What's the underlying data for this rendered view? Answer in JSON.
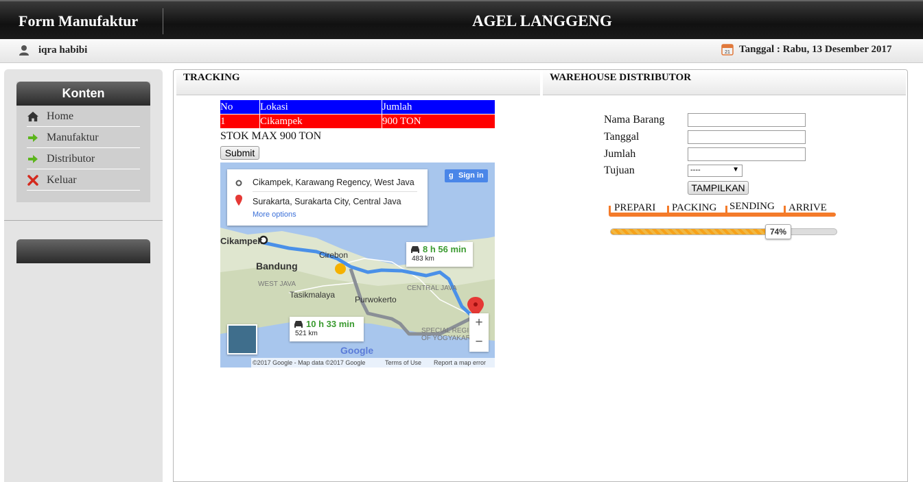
{
  "header": {
    "app_title": "Form Manufaktur",
    "company": "AGEL LANGGENG"
  },
  "userbar": {
    "user_name": "iqra habibi",
    "date_text": "Tanggal : Rabu, 13 Desember 2017"
  },
  "sidebar": {
    "menu_title": "Konten",
    "items": [
      {
        "label": "Home",
        "icon": "home-icon"
      },
      {
        "label": "Manufaktur",
        "icon": "arrow-right-icon"
      },
      {
        "label": "Distributor",
        "icon": "arrow-right-icon"
      },
      {
        "label": "Keluar",
        "icon": "close-icon"
      }
    ]
  },
  "tracking": {
    "title": "TRACKING",
    "columns": [
      "No",
      "Lokasi",
      "Jumlah"
    ],
    "rows": [
      {
        "no": "1",
        "lokasi": "Cikampek",
        "jumlah": "900 TON"
      }
    ],
    "stok_text": "STOK MAX 900 TON",
    "submit_label": "Submit",
    "map": {
      "origin": "Cikampek, Karawang Regency, West Java",
      "destination": "Surakarta, Surakarta City, Central Java",
      "more_options": "More options",
      "sign_in": "Sign in",
      "route1_time": "8 h 56 min",
      "route1_distance": "483 km",
      "route2_time": "10 h 33 min",
      "route2_distance": "521 km",
      "labels": {
        "cikampek": "Cikampek",
        "bandung": "Bandung",
        "cirebon": "Cirebon",
        "west_java": "WEST JAVA",
        "tasikmalaya": "Tasikmalaya",
        "purwokerto": "Purwokerto",
        "central_java": "CENTRAL JAVA",
        "special_region": "SPECIAL REGI",
        "of_yogyakarta": "OF YOGYAKAR",
        "google": "Google"
      },
      "footer_copy": "©2017 Google - Map data ©2017 Google",
      "footer_terms": "Terms of Use",
      "footer_report": "Report a map error"
    }
  },
  "warehouse": {
    "title": "WAREHOUSE DISTRIBUTOR",
    "fields": {
      "nama_barang": "Nama Barang",
      "tanggal": "Tanggal",
      "jumlah": "Jumlah",
      "tujuan": "Tujuan"
    },
    "tujuan_selected": "----",
    "button_label": "TAMPILKAN",
    "steps": [
      "PREPARI",
      "PACKING",
      "SENDING",
      "ARRIVE"
    ],
    "progress_percent": 74,
    "progress_label": "74%"
  }
}
